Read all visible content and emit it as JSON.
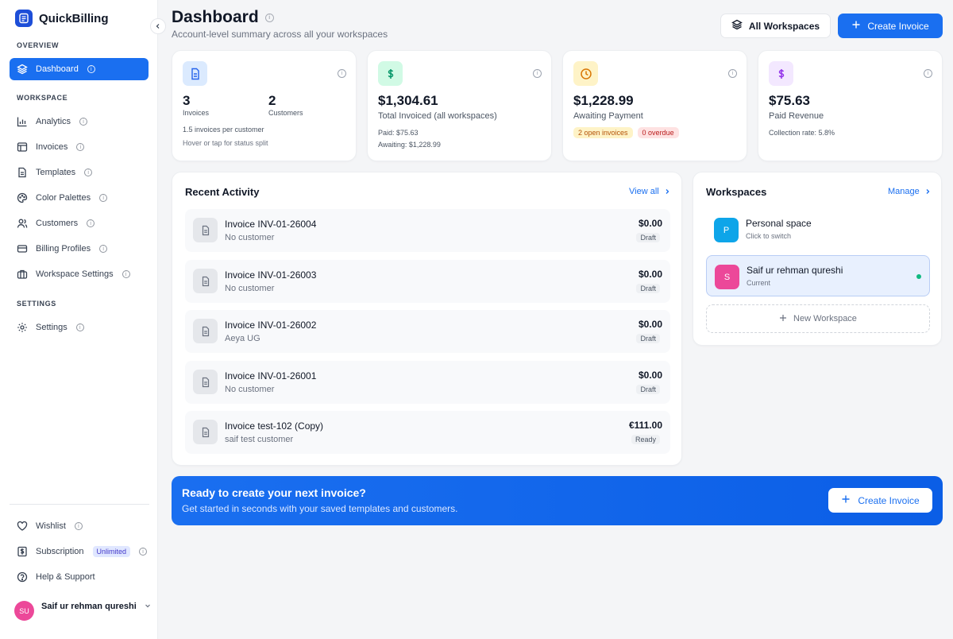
{
  "app": {
    "name": "QuickBilling"
  },
  "sidebar": {
    "sections": {
      "overview": "OVERVIEW",
      "workspace": "WORKSPACE",
      "settings": "SETTINGS"
    },
    "items": [
      {
        "label": "Dashboard"
      },
      {
        "label": "Analytics"
      },
      {
        "label": "Invoices"
      },
      {
        "label": "Templates"
      },
      {
        "label": "Color Palettes"
      },
      {
        "label": "Customers"
      },
      {
        "label": "Billing Profiles"
      },
      {
        "label": "Workspace Settings"
      },
      {
        "label": "Settings"
      }
    ],
    "bottom": [
      {
        "label": "Wishlist"
      },
      {
        "label": "Subscription",
        "badge": "Unlimited"
      },
      {
        "label": "Help & Support"
      }
    ],
    "user": {
      "initials": "SU",
      "name": "Saif ur rehman qureshi"
    }
  },
  "header": {
    "title": "Dashboard",
    "subtitle": "Account-level summary across all your workspaces",
    "workspace_button": "All Workspaces",
    "create_button": "Create Invoice"
  },
  "stats": {
    "counts": {
      "invoices_value": "3",
      "invoices_label": "Invoices",
      "customers_value": "2",
      "customers_label": "Customers",
      "ratio": "1.5 invoices per customer",
      "hint": "Hover or tap for status split"
    },
    "invoiced": {
      "value": "$1,304.61",
      "label": "Total Invoiced (all workspaces)",
      "paid": "Paid: $75.63",
      "awaiting": "Awaiting: $1,228.99"
    },
    "awaiting": {
      "value": "$1,228.99",
      "label": "Awaiting Payment",
      "open_chip": "2 open invoices",
      "overdue_chip": "0 overdue"
    },
    "paid": {
      "value": "$75.63",
      "label": "Paid Revenue",
      "collection": "Collection rate: 5.8%"
    }
  },
  "activity": {
    "title": "Recent Activity",
    "link": "View all",
    "rows": [
      {
        "name": "Invoice INV-01-26004",
        "customer": "No customer",
        "amount": "$0.00",
        "status": "Draft"
      },
      {
        "name": "Invoice INV-01-26003",
        "customer": "No customer",
        "amount": "$0.00",
        "status": "Draft"
      },
      {
        "name": "Invoice INV-01-26002",
        "customer": "Aeya UG",
        "amount": "$0.00",
        "status": "Draft"
      },
      {
        "name": "Invoice INV-01-26001",
        "customer": "No customer",
        "amount": "$0.00",
        "status": "Draft"
      },
      {
        "name": "Invoice test-102 (Copy)",
        "customer": "saif test customer",
        "amount": "€111.00",
        "status": "Ready"
      }
    ]
  },
  "workspaces": {
    "title": "Workspaces",
    "link": "Manage",
    "items": [
      {
        "initial": "P",
        "name": "Personal space",
        "sub": "Click to switch",
        "color": "#0ea5e9"
      },
      {
        "initial": "S",
        "name": "Saif ur rehman qureshi",
        "sub": "Current",
        "color": "#ec4899"
      }
    ],
    "new_label": "New Workspace"
  },
  "cta": {
    "title": "Ready to create your next invoice?",
    "subtitle": "Get started in seconds with your saved templates and customers.",
    "button": "Create Invoice"
  },
  "colors": {
    "accent": "#1a6ff0",
    "success": "#10b981",
    "warning_bg": "#fef3c7",
    "danger_bg": "#fee2e2"
  }
}
